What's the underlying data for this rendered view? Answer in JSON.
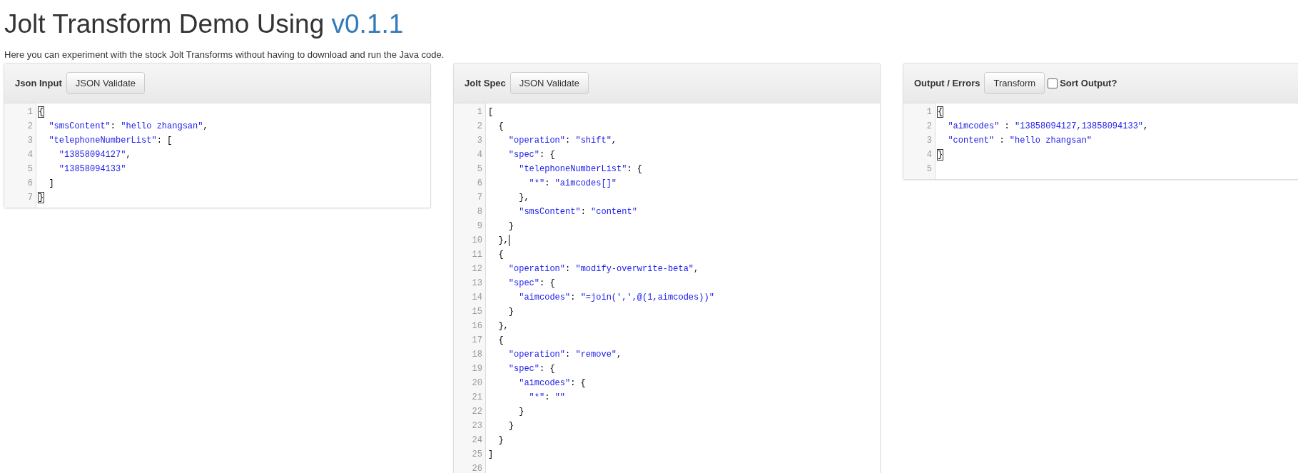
{
  "page": {
    "title": "Jolt Transform Demo Using ",
    "version": "v0.1.1",
    "subtitle": "Here you can experiment with the stock Jolt Transforms without having to download and run the Java code."
  },
  "panels": [
    {
      "title": "Json Input",
      "button": "JSON Validate",
      "lines": [
        {
          "number": "1",
          "segments": [
            {
              "text": "{",
              "kind": "bracket"
            }
          ]
        },
        {
          "number": "2",
          "segments": [
            {
              "text": "  \"smsContent\"",
              "kind": "string"
            },
            {
              "text": ": ",
              "kind": "plain"
            },
            {
              "text": "\"hello zhangsan\"",
              "kind": "string"
            },
            {
              "text": ",",
              "kind": "plain"
            }
          ]
        },
        {
          "number": "3",
          "segments": [
            {
              "text": "  \"telephoneNumberList\"",
              "kind": "string"
            },
            {
              "text": ": [",
              "kind": "plain"
            }
          ]
        },
        {
          "number": "4",
          "segments": [
            {
              "text": "    \"13858094127\"",
              "kind": "string"
            },
            {
              "text": ",",
              "kind": "plain"
            }
          ]
        },
        {
          "number": "5",
          "segments": [
            {
              "text": "    \"13858094133\"",
              "kind": "string"
            }
          ]
        },
        {
          "number": "6",
          "segments": [
            {
              "text": "  ]",
              "kind": "plain"
            }
          ]
        },
        {
          "number": "7",
          "segments": [
            {
              "text": "}",
              "kind": "bracket"
            }
          ]
        }
      ]
    },
    {
      "title": "Jolt Spec",
      "button": "JSON Validate",
      "lines": [
        {
          "number": "1",
          "segments": [
            {
              "text": "[",
              "kind": "plain"
            }
          ]
        },
        {
          "number": "2",
          "segments": [
            {
              "text": "  {",
              "kind": "plain"
            }
          ]
        },
        {
          "number": "3",
          "segments": [
            {
              "text": "    \"operation\"",
              "kind": "string"
            },
            {
              "text": ": ",
              "kind": "plain"
            },
            {
              "text": "\"shift\"",
              "kind": "string"
            },
            {
              "text": ",",
              "kind": "plain"
            }
          ]
        },
        {
          "number": "4",
          "segments": [
            {
              "text": "    \"spec\"",
              "kind": "string"
            },
            {
              "text": ": {",
              "kind": "plain"
            }
          ]
        },
        {
          "number": "5",
          "segments": [
            {
              "text": "      \"telephoneNumberList\"",
              "kind": "string"
            },
            {
              "text": ": {",
              "kind": "plain"
            }
          ]
        },
        {
          "number": "6",
          "segments": [
            {
              "text": "        \"*\"",
              "kind": "string"
            },
            {
              "text": ": ",
              "kind": "plain"
            },
            {
              "text": "\"aimcodes[]\"",
              "kind": "string"
            }
          ]
        },
        {
          "number": "7",
          "segments": [
            {
              "text": "      },",
              "kind": "plain"
            }
          ]
        },
        {
          "number": "8",
          "segments": [
            {
              "text": "      \"smsContent\"",
              "kind": "string"
            },
            {
              "text": ": ",
              "kind": "plain"
            },
            {
              "text": "\"content\"",
              "kind": "string"
            }
          ]
        },
        {
          "number": "9",
          "segments": [
            {
              "text": "    }",
              "kind": "plain"
            }
          ]
        },
        {
          "number": "10",
          "cursor": true,
          "segments": [
            {
              "text": "  },",
              "kind": "plain"
            }
          ]
        },
        {
          "number": "11",
          "segments": [
            {
              "text": "  {",
              "kind": "plain"
            }
          ]
        },
        {
          "number": "12",
          "segments": [
            {
              "text": "    \"operation\"",
              "kind": "string"
            },
            {
              "text": ": ",
              "kind": "plain"
            },
            {
              "text": "\"modify-overwrite-beta\"",
              "kind": "string"
            },
            {
              "text": ",",
              "kind": "plain"
            }
          ]
        },
        {
          "number": "13",
          "segments": [
            {
              "text": "    \"spec\"",
              "kind": "string"
            },
            {
              "text": ": {",
              "kind": "plain"
            }
          ]
        },
        {
          "number": "14",
          "segments": [
            {
              "text": "      \"aimcodes\"",
              "kind": "string"
            },
            {
              "text": ": ",
              "kind": "plain"
            },
            {
              "text": "\"=join(',',@(1,aimcodes))\"",
              "kind": "string"
            }
          ]
        },
        {
          "number": "15",
          "segments": [
            {
              "text": "    }",
              "kind": "plain"
            }
          ]
        },
        {
          "number": "16",
          "segments": [
            {
              "text": "  },",
              "kind": "plain"
            }
          ]
        },
        {
          "number": "17",
          "segments": [
            {
              "text": "  {",
              "kind": "plain"
            }
          ]
        },
        {
          "number": "18",
          "segments": [
            {
              "text": "    \"operation\"",
              "kind": "string"
            },
            {
              "text": ": ",
              "kind": "plain"
            },
            {
              "text": "\"remove\"",
              "kind": "string"
            },
            {
              "text": ",",
              "kind": "plain"
            }
          ]
        },
        {
          "number": "19",
          "segments": [
            {
              "text": "    \"spec\"",
              "kind": "string"
            },
            {
              "text": ": {",
              "kind": "plain"
            }
          ]
        },
        {
          "number": "20",
          "segments": [
            {
              "text": "      \"aimcodes\"",
              "kind": "string"
            },
            {
              "text": ": {",
              "kind": "plain"
            }
          ]
        },
        {
          "number": "21",
          "segments": [
            {
              "text": "        \"*\"",
              "kind": "string"
            },
            {
              "text": ": ",
              "kind": "plain"
            },
            {
              "text": "\"\"",
              "kind": "string"
            }
          ]
        },
        {
          "number": "22",
          "segments": [
            {
              "text": "      }",
              "kind": "plain"
            }
          ]
        },
        {
          "number": "23",
          "segments": [
            {
              "text": "    }",
              "kind": "plain"
            }
          ]
        },
        {
          "number": "24",
          "segments": [
            {
              "text": "  }",
              "kind": "plain"
            }
          ]
        },
        {
          "number": "25",
          "segments": [
            {
              "text": "]",
              "kind": "plain"
            }
          ]
        },
        {
          "number": "26"
        }
      ]
    },
    {
      "title": "Output / Errors",
      "button": "Transform",
      "checkbox": {
        "label": "Sort Output?",
        "checked": false
      },
      "lines": [
        {
          "number": "1",
          "segments": [
            {
              "text": "{",
              "kind": "bracket"
            }
          ]
        },
        {
          "number": "2",
          "segments": [
            {
              "text": "  \"aimcodes\"",
              "kind": "string"
            },
            {
              "text": " : ",
              "kind": "plain"
            },
            {
              "text": "\"13858094127,13858094133\"",
              "kind": "string"
            },
            {
              "text": ",",
              "kind": "plain"
            }
          ]
        },
        {
          "number": "3",
          "segments": [
            {
              "text": "  \"content\"",
              "kind": "string"
            },
            {
              "text": " : ",
              "kind": "plain"
            },
            {
              "text": "\"hello zhangsan\"",
              "kind": "string"
            }
          ]
        },
        {
          "number": "4",
          "segments": [
            {
              "text": "}",
              "kind": "bracket"
            }
          ]
        },
        {
          "number": "5"
        }
      ]
    }
  ]
}
